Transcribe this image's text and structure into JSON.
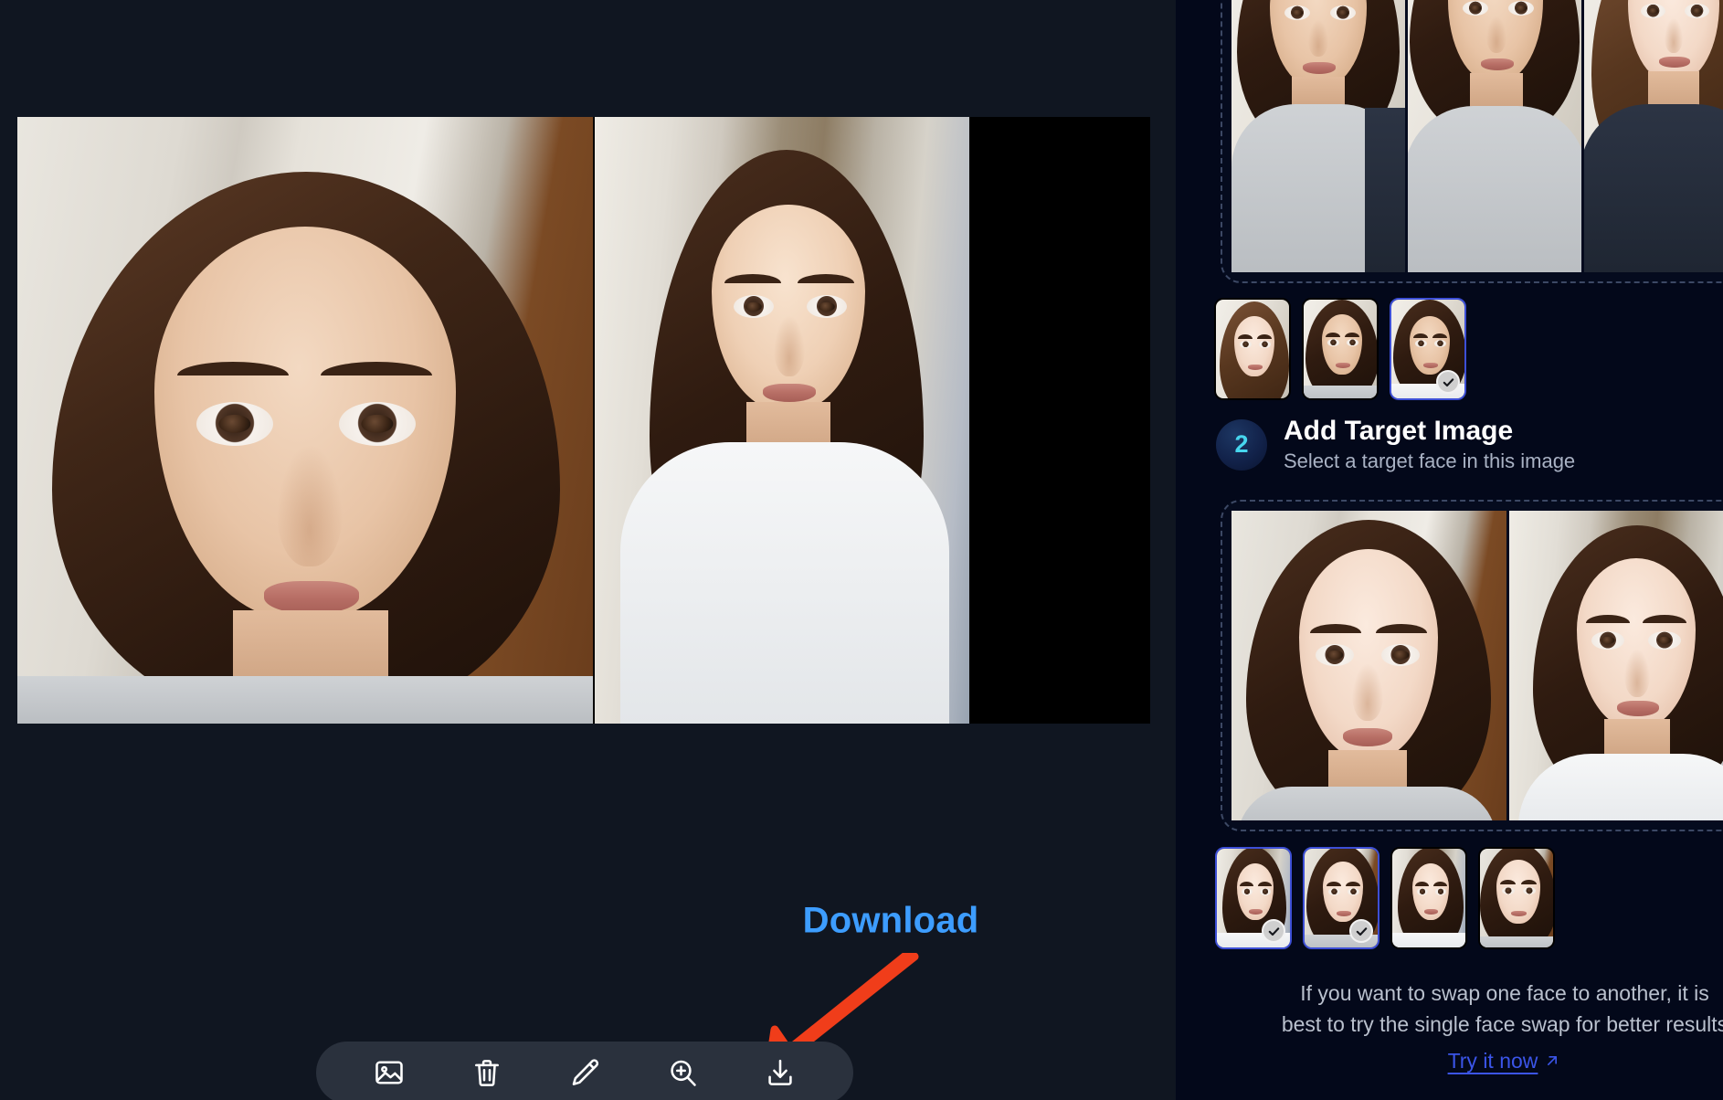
{
  "app": {
    "background_color": "#101621",
    "panel_color": "#03081a",
    "accent_blue": "#3d9dff",
    "link_blue": "#3b55e8",
    "arrow_color": "#f03d1a",
    "selection_border": "#3d4fd6"
  },
  "result": {
    "download_label": "Download",
    "arrow_name": "red-annotation-arrow",
    "image_alt_left": "swapped-face-result-closeup",
    "image_alt_right": "swapped-face-result-portrait"
  },
  "toolbar": {
    "buttons": [
      {
        "name": "change-image-button",
        "icon": "image-icon",
        "label": "Change image"
      },
      {
        "name": "delete-button",
        "icon": "trash-icon",
        "label": "Delete"
      },
      {
        "name": "edit-button",
        "icon": "pencil-icon",
        "label": "Edit"
      },
      {
        "name": "zoom-button",
        "icon": "zoom-in-icon",
        "label": "Zoom"
      },
      {
        "name": "download-button",
        "icon": "download-icon",
        "label": "Download"
      }
    ]
  },
  "sidebar": {
    "source_card": {
      "name": "source-image-upload-card",
      "face_count": 3
    },
    "source_faces": [
      {
        "label": "face-1",
        "selected": false,
        "checked": false
      },
      {
        "label": "face-2",
        "selected": false,
        "checked": false
      },
      {
        "label": "face-3",
        "selected": true,
        "checked": true
      }
    ],
    "step": {
      "number": "2",
      "title": "Add Target Image",
      "subtitle": "Select a target face in this image"
    },
    "target_card": {
      "name": "target-image-upload-card",
      "face_count": 2
    },
    "target_faces": [
      {
        "label": "target-face-1",
        "selected": true,
        "checked": true
      },
      {
        "label": "target-face-2",
        "selected": true,
        "checked": true
      },
      {
        "label": "target-face-3",
        "selected": false,
        "checked": false
      },
      {
        "label": "target-face-4",
        "selected": false,
        "checked": false
      }
    ],
    "hint": {
      "line1": "If you want to swap one face to another, it is",
      "line2": "best to try the single face swap for better results",
      "link_label": "Try it now",
      "link_icon": "external-link-arrow-icon"
    }
  }
}
